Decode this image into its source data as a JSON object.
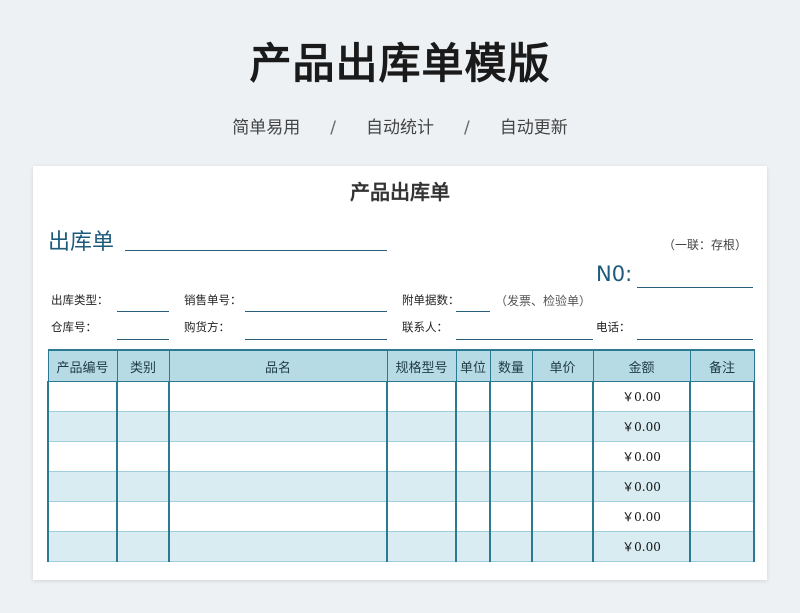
{
  "banner": {
    "title": "产品出库单模版",
    "features": [
      "简单易用",
      "自动统计",
      "自动更新"
    ],
    "separator": "/"
  },
  "sheet": {
    "title": "产品出库单",
    "doc_label": "出库单",
    "copy_note": "（一联：存根）",
    "no_label": "N0:",
    "fields": {
      "out_type": "出库类型：",
      "sales_no": "销售单号：",
      "attach_count": "附单据数：",
      "attach_note": "（发票、检验单）",
      "warehouse_no": "仓库号：",
      "buyer": "购货方：",
      "contact": "联系人：",
      "phone": "电话："
    },
    "columns": [
      "产品编号",
      "类别",
      "品名",
      "规格型号",
      "单位",
      "数量",
      "单价",
      "金额",
      "备注"
    ],
    "rows": [
      {
        "amount": "￥0.00"
      },
      {
        "amount": "￥0.00"
      },
      {
        "amount": "￥0.00"
      },
      {
        "amount": "￥0.00"
      },
      {
        "amount": "￥0.00"
      },
      {
        "amount": "￥0.00"
      }
    ]
  },
  "colors": {
    "header_fill": "#b6dbe4",
    "row_stripe": "#d8ecf2",
    "border": "#2b7a92",
    "label_blue": "#1e5a7a"
  }
}
